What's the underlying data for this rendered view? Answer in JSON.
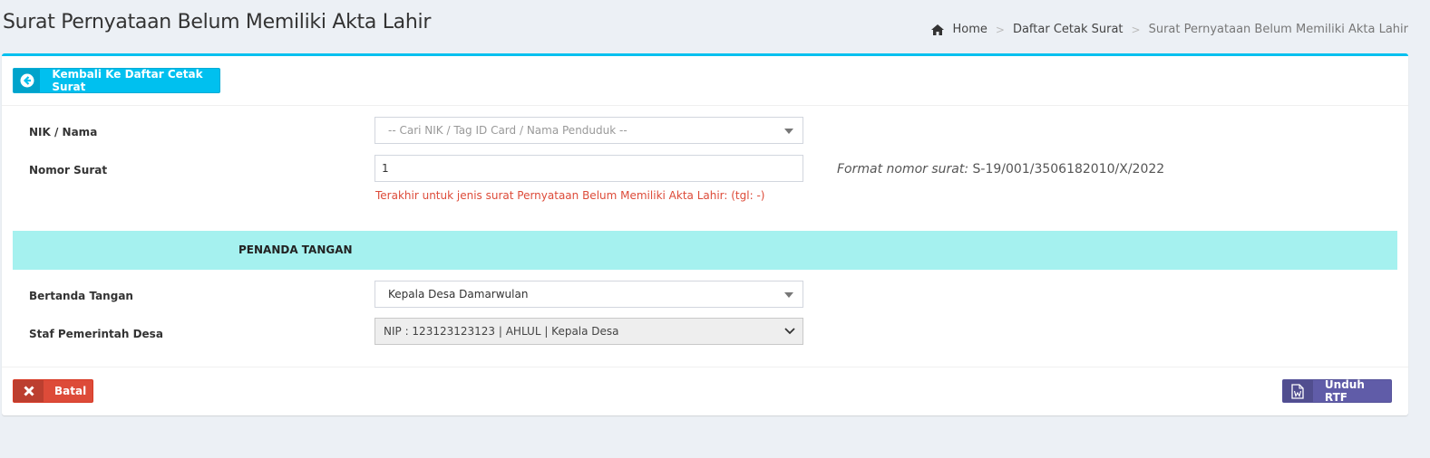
{
  "page": {
    "title": "Surat Pernyataan Belum Memiliki Akta Lahir"
  },
  "breadcrumb": {
    "home": "Home",
    "list": "Daftar Cetak Surat",
    "current": "Surat Pernyataan Belum Memiliki Akta Lahir",
    "separator": ">"
  },
  "header": {
    "back_label": "Kembali Ke Daftar Cetak Surat"
  },
  "form": {
    "nik_label": "NIK / Nama",
    "nik_placeholder": "-- Cari NIK / Tag ID Card / Nama Penduduk --",
    "nomor_label": "Nomor Surat",
    "nomor_value": "1",
    "nomor_help": "Terakhir untuk jenis surat Pernyataan Belum Memiliki Akta Lahir: (tgl: -)",
    "format_label": "Format nomor surat:",
    "format_value": "S-19/001/3506182010/X/2022"
  },
  "signer": {
    "section_title": "PENANDA TANGAN",
    "bertanda_label": "Bertanda Tangan",
    "bertanda_value": "Kepala Desa Damarwulan",
    "staf_label": "Staf Pemerintah Desa",
    "staf_value": "NIP : 123123123123 | AHLUL | Kepala Desa"
  },
  "footer": {
    "cancel_label": "Batal",
    "download_label": "Unduh RTF"
  },
  "colors": {
    "primary": "#00c0ef",
    "danger": "#dd4b39",
    "purple": "#605ca8",
    "section_bg": "#a5f1ef"
  },
  "icons": {
    "home": "home-icon",
    "back": "arrow-circle-left-icon",
    "cancel": "close-icon",
    "download": "word-file-icon",
    "dropdown": "caret-down-icon",
    "chevron": "chevron-down-icon"
  }
}
